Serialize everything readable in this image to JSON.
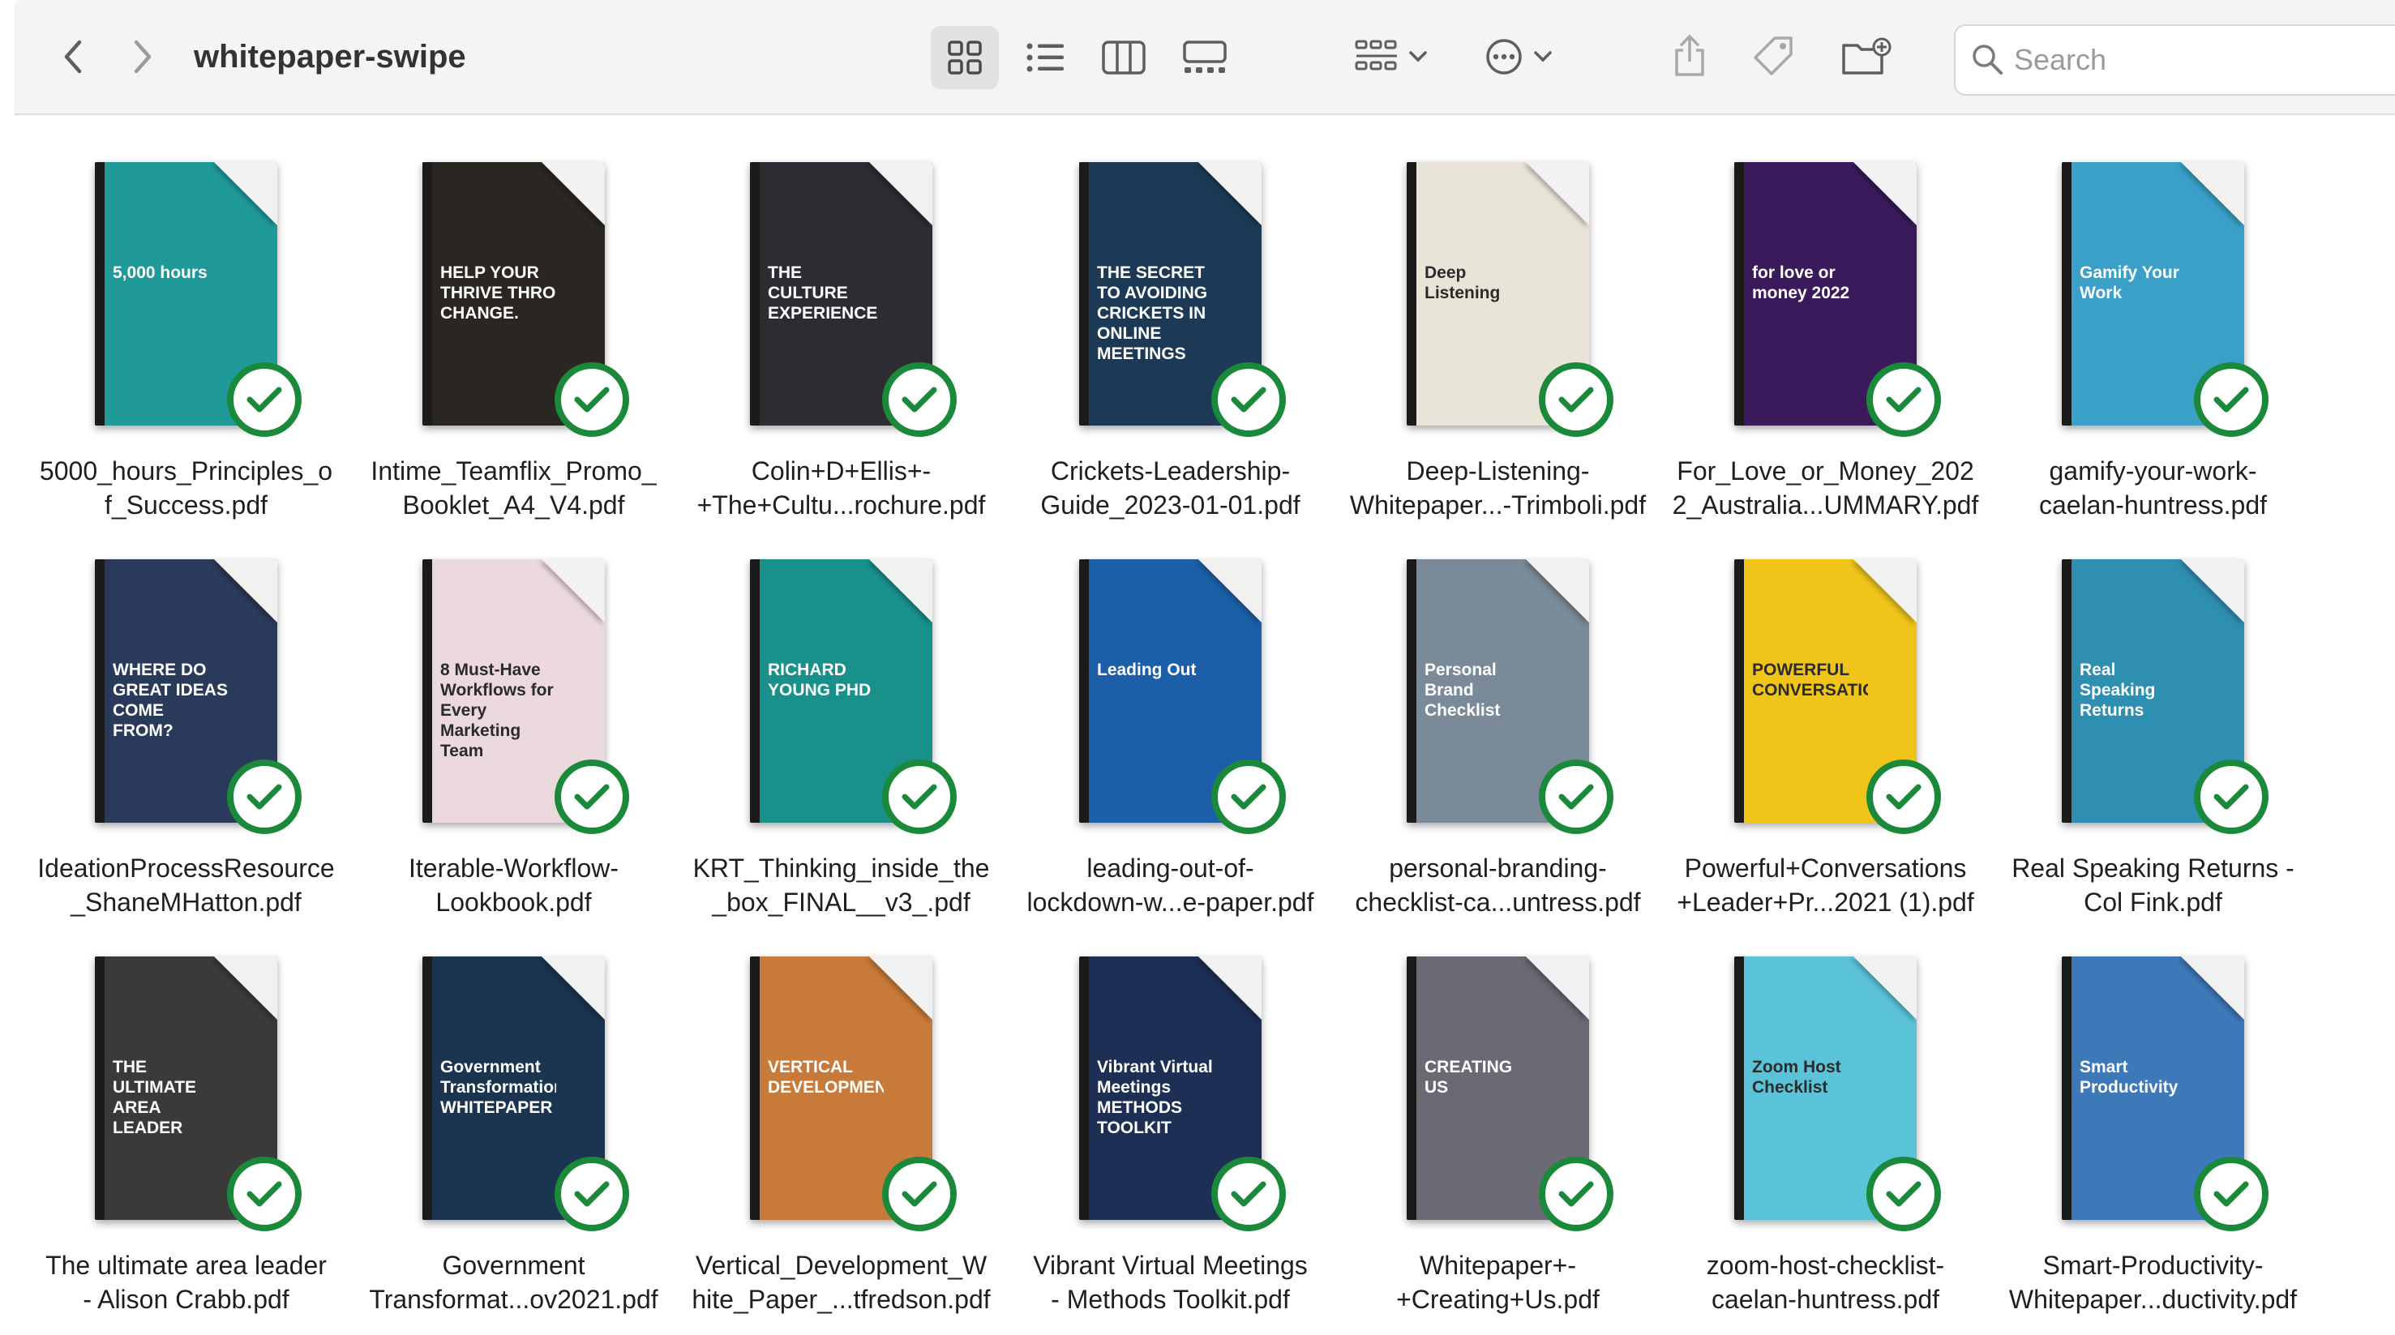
{
  "window": {
    "title": "whitepaper-swipe"
  },
  "toolbar": {
    "back_icon": "chevron-left-icon",
    "forward_icon": "chevron-right-icon",
    "views": [
      "icon-view-icon",
      "list-view-icon",
      "column-view-icon",
      "gallery-view-icon"
    ],
    "selected_view": "icon",
    "group_icon": "group-by-icon",
    "more_icon": "ellipsis-circle-icon",
    "share_icon": "share-icon",
    "tag_icon": "tag-icon",
    "new_folder_icon": "new-folder-icon",
    "search_placeholder": "Search"
  },
  "colors": {
    "check_green": "#1a8a3a",
    "toolbar_bg": "#f4f4f4",
    "selected_view_bg": "#e2e2e2"
  },
  "files": [
    {
      "name": "5000_hours_Principles_o\nf_Success.pdf",
      "status": "synced",
      "cover_color": "#1f9a99",
      "cover_text": "5,000 hours"
    },
    {
      "name": "Intime_Teamflix_Promo_\nBooklet_A4_V4.pdf",
      "status": "synced",
      "cover_color": "#2a2622",
      "cover_text": "HELP YOUR THRIVE THRO CHANGE."
    },
    {
      "name": "Colin+D+Ellis+-\n+The+Cultu...rochure.pdf",
      "status": "synced",
      "cover_color": "#2f2b33",
      "cover_text": "THE CULTURE EXPERIENCE"
    },
    {
      "name": "Crickets-Leadership-\nGuide_2023-01-01.pdf",
      "status": "synced",
      "cover_color": "#1c3a55",
      "cover_text": "THE SECRET TO AVOIDING CRICKETS IN ONLINE MEETINGS"
    },
    {
      "name": "Deep-Listening-\nWhitepaper...-Trimboli.pdf",
      "status": "synced",
      "cover_color": "#e9e4d8",
      "cover_text": "Deep Listening"
    },
    {
      "name": "For_Love_or_Money_202\n2_Australia...UMMARY.pdf",
      "status": "synced",
      "cover_color": "#3a1a5a",
      "cover_text": "for love or money 2022"
    },
    {
      "name": "gamify-your-work-\ncaelan-huntress.pdf",
      "status": "synced",
      "cover_color": "#3aa0c8",
      "cover_text": "Gamify Your Work"
    },
    {
      "name": "IdeationProcessResource\n_ShaneMHatton.pdf",
      "status": "synced",
      "cover_color": "#2a3a5a",
      "cover_text": "WHERE DO GREAT IDEAS COME FROM?"
    },
    {
      "name": "Iterable-Workflow-\nLookbook.pdf",
      "status": "synced",
      "cover_color": "#ecd9dd",
      "cover_text": "8 Must-Have Workflows for Every Marketing Team"
    },
    {
      "name": "KRT_Thinking_inside_the\n_box_FINAL__v3_.pdf",
      "status": "synced",
      "cover_color": "#19908a",
      "cover_text": "RICHARD YOUNG PHD"
    },
    {
      "name": "leading-out-of-\nlockdown-w...e-paper.pdf",
      "status": "synced",
      "cover_color": "#1c5fa8",
      "cover_text": "Leading Out"
    },
    {
      "name": "personal-branding-\nchecklist-ca...untress.pdf",
      "status": "synced",
      "cover_color": "#7a8a98",
      "cover_text": "Personal Brand Checklist"
    },
    {
      "name": "Powerful+Conversations\n+Leader+Pr...2021 (1).pdf",
      "status": "synced",
      "cover_color": "#f0c419",
      "cover_text": "POWERFUL CONVERSATIONS"
    },
    {
      "name": "Real Speaking Returns -\nCol Fink.pdf",
      "status": "synced",
      "cover_color": "#2f8fb0",
      "cover_text": "Real Speaking Returns"
    },
    {
      "name": "The ultimate area leader\n- Alison Crabb.pdf",
      "status": "synced",
      "cover_color": "#3a3a3a",
      "cover_text": "THE ULTIMATE AREA LEADER"
    },
    {
      "name": "Government\nTransformat...ov2021.pdf",
      "status": "synced",
      "cover_color": "#1b3550",
      "cover_text": "Government Transformation WHITEPAPER"
    },
    {
      "name": "Vertical_Development_W\nhite_Paper_...tfredson.pdf",
      "status": "synced",
      "cover_color": "#c87a3a",
      "cover_text": "VERTICAL DEVELOPMENT"
    },
    {
      "name": "Vibrant Virtual Meetings\n- Methods Toolkit.pdf",
      "status": "synced",
      "cover_color": "#1d2f54",
      "cover_text": "Vibrant Virtual Meetings METHODS TOOLKIT"
    },
    {
      "name": "Whitepaper+-\n+Creating+Us.pdf",
      "status": "synced",
      "cover_color": "#6a6a74",
      "cover_text": "CREATING US"
    },
    {
      "name": "zoom-host-checklist-\ncaelan-huntress.pdf",
      "status": "synced",
      "cover_color": "#5bc3d8",
      "cover_text": "Zoom Host Checklist"
    },
    {
      "name": "Smart-Productivity-\nWhitepaper...ductivity.pdf",
      "status": "synced",
      "cover_color": "#3d78b8",
      "cover_text": "Smart Productivity"
    }
  ]
}
